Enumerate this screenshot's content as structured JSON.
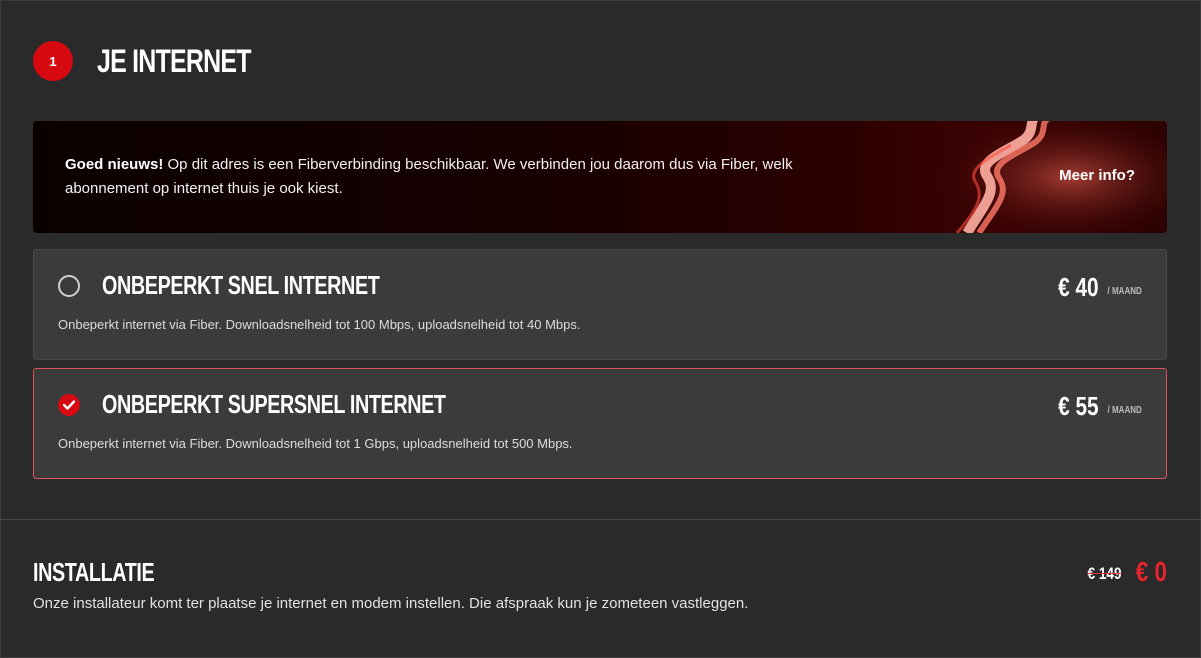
{
  "step": {
    "number": "1",
    "title": "JE INTERNET"
  },
  "banner": {
    "bold_text": "Goed nieuws!",
    "text": " Op dit adres is een Fiberverbinding beschikbaar. We verbinden jou daarom dus via Fiber, welk abonnement op internet thuis je ook kiest.",
    "link_label": "Meer info?"
  },
  "options": [
    {
      "title": "ONBEPERKT SNEL INTERNET",
      "description": "Onbeperkt internet via Fiber. Downloadsnelheid tot 100 Mbps, uploadsnelheid tot 40 Mbps.",
      "price": "€ 40",
      "price_unit": "/ MAAND",
      "selected": false
    },
    {
      "title": "ONBEPERKT SUPERSNEL INTERNET",
      "description": "Onbeperkt internet via Fiber. Downloadsnelheid tot 1 Gbps, uploadsnelheid tot 500 Mbps.",
      "price": "€ 55",
      "price_unit": "/ MAAND",
      "selected": true
    }
  ],
  "installation": {
    "title": "INSTALLATIE",
    "description": "Onze installateur komt ter plaatse je internet en modem instellen. Die afspraak kun je zometeen vastleggen.",
    "old_price": "€ 149",
    "new_price": "€ 0"
  },
  "colors": {
    "accent": "#d70a12",
    "background": "#2a2a2a",
    "card": "#3b3b3b",
    "selected_border": "#e0575b"
  },
  "icons": {
    "checked_radio": "check-icon",
    "banner_art": "fiber-cable-icon"
  }
}
